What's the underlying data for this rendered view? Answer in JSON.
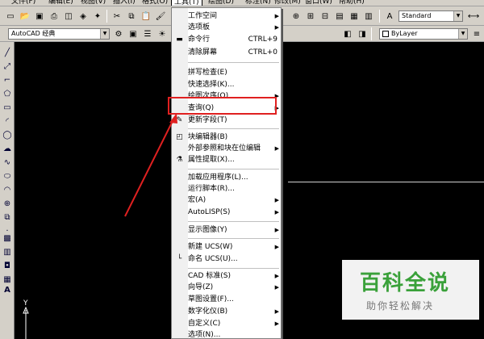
{
  "menubar": {
    "items": [
      "文件(F)",
      "编辑(E)",
      "视图(V)",
      "插入(I)",
      "格式(O)",
      "工具(T)",
      "绘图(D)",
      "标注(N)",
      "修改(M)",
      "窗口(W)",
      "帮助(H)"
    ]
  },
  "toolbar": {
    "text_style": "Standard",
    "workspace": "AutoCAD 经典",
    "layer": "ByLayer"
  },
  "tools_menu": {
    "items": [
      {
        "label": "工作空间",
        "submenu": true
      },
      {
        "label": "选项板",
        "submenu": true
      },
      {
        "label": "命令行",
        "shortcut": "CTRL+9",
        "icon": "command-line-icon"
      },
      {
        "label": "清除屏幕",
        "shortcut": "CTRL+0"
      },
      {
        "label": "拼写检查(E)"
      },
      {
        "label": "快速选择(K)..."
      },
      {
        "label": "绘图次序(O)",
        "submenu": true
      },
      {
        "label": "查询(Q)",
        "submenu": true
      },
      {
        "label": "更新字段(T)",
        "icon": "update-field-icon"
      },
      {
        "label": "块编辑器(B)",
        "icon": "block-editor-icon"
      },
      {
        "label": "外部参照和块在位编辑",
        "submenu": true
      },
      {
        "label": "属性提取(X)...",
        "icon": "attribute-extract-icon"
      },
      {
        "label": "加载应用程序(L)..."
      },
      {
        "label": "运行脚本(R)..."
      },
      {
        "label": "宏(A)",
        "submenu": true
      },
      {
        "label": "AutoLISP(S)",
        "submenu": true
      },
      {
        "label": "显示图像(Y)",
        "submenu": true
      },
      {
        "label": "新建 UCS(W)",
        "submenu": true
      },
      {
        "label": "命名 UCS(U)...",
        "icon": "named-ucs-icon"
      },
      {
        "label": "CAD 标准(S)",
        "submenu": true
      },
      {
        "label": "向导(Z)",
        "submenu": true
      },
      {
        "label": "草图设置(F)..."
      },
      {
        "label": "数字化仪(B)",
        "submenu": true
      },
      {
        "label": "自定义(C)",
        "submenu": true
      },
      {
        "label": "选项(N)..."
      }
    ]
  },
  "ucs_icon": {
    "y_label": "Y"
  },
  "watermark": {
    "title": "百科全说",
    "subtitle": "助你轻松解决"
  },
  "colors": {
    "highlight_box": "#e02020",
    "watermark_green": "#3aa13a"
  }
}
